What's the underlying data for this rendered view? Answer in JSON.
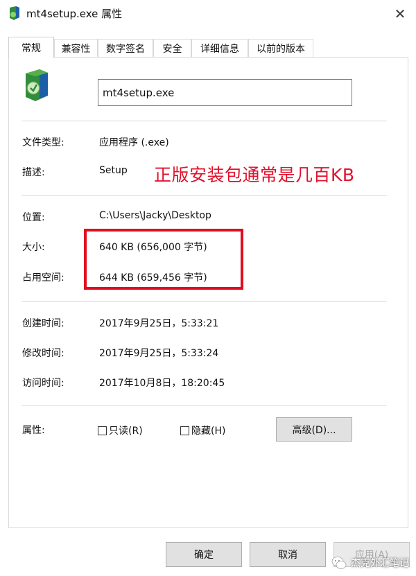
{
  "window": {
    "title": "mt4setup.exe 属性",
    "close_glyph": "✕"
  },
  "tabs": [
    "常规",
    "兼容性",
    "数字签名",
    "安全",
    "详细信息",
    "以前的版本"
  ],
  "file": {
    "name": "mt4setup.exe",
    "type_label": "文件类型:",
    "type_value": "应用程序 (.exe)",
    "desc_label": "描述:",
    "desc_value": "Setup",
    "location_label": "位置:",
    "location_value": "C:\\Users\\Jacky\\Desktop",
    "size_label": "大小:",
    "size_value": "640 KB (656,000 字节)",
    "disk_label": "占用空间:",
    "disk_value": "644 KB (659,456 字节)",
    "created_label": "创建时间:",
    "created_value": "2017年9月25日，5:33:21",
    "modified_label": "修改时间:",
    "modified_value": "2017年9月25日，5:33:24",
    "accessed_label": "访问时间:",
    "accessed_value": "2017年10月8日，18:20:45"
  },
  "attributes": {
    "label": "属性:",
    "readonly": "只读(R)",
    "hidden": "隐藏(H)",
    "advanced_button": "高级(D)..."
  },
  "annotation": {
    "text": "正版安装包通常是几百KB",
    "color": "#e2122c"
  },
  "buttons": {
    "ok": "确定",
    "cancel": "取消",
    "apply": "应用(A)"
  },
  "watermark": {
    "text": "杰克外汇笔记"
  }
}
